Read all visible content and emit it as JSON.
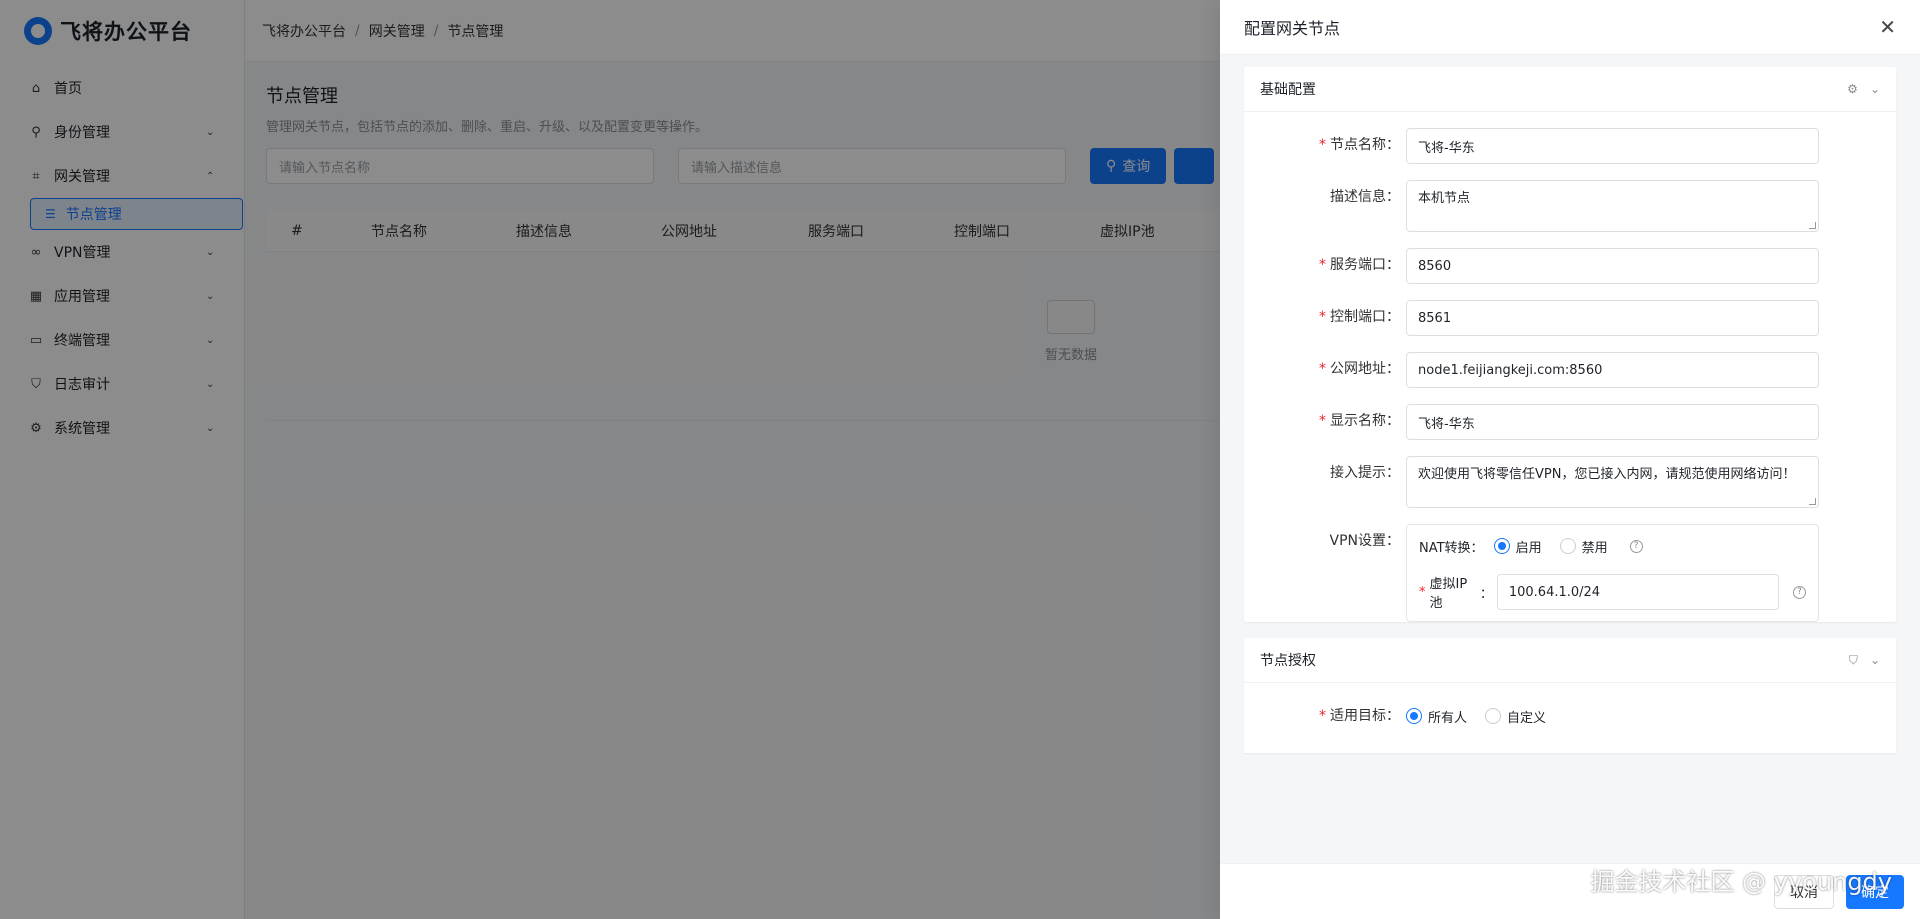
{
  "app": {
    "name": "飞将办公平台"
  },
  "sidebar": {
    "items": [
      {
        "label": "首页",
        "icon": "home-icon",
        "has_arrow": false
      },
      {
        "label": "身份管理",
        "icon": "user-icon",
        "has_arrow": true
      },
      {
        "label": "网关管理",
        "icon": "gateway-icon",
        "has_arrow": true,
        "expanded": true
      },
      {
        "label": "VPN管理",
        "icon": "link-icon",
        "has_arrow": true
      },
      {
        "label": "应用管理",
        "icon": "grid-icon",
        "has_arrow": true
      },
      {
        "label": "终端管理",
        "icon": "laptop-icon",
        "has_arrow": true
      },
      {
        "label": "日志审计",
        "icon": "shield-icon",
        "has_arrow": true
      },
      {
        "label": "系统管理",
        "icon": "gear-icon",
        "has_arrow": true
      }
    ],
    "sub_active": {
      "label": "节点管理",
      "icon": "list-icon"
    }
  },
  "breadcrumb": [
    "飞将办公平台",
    "网关管理",
    "节点管理"
  ],
  "page": {
    "title": "节点管理",
    "description": "管理网关节点，包括节点的添加、删除、重启、升级、以及配置变更等操作。",
    "filters": {
      "name_placeholder": "请输入节点名称",
      "desc_placeholder": "请输入描述信息",
      "query_label": "查询"
    },
    "columns": [
      "#",
      "节点名称",
      "描述信息",
      "公网地址",
      "服务端口",
      "控制端口",
      "虚拟IP池"
    ],
    "empty_text": "暂无数据"
  },
  "drawer": {
    "title": "配置网关节点",
    "close_icon": "close-icon",
    "basic": {
      "title": "基础配置",
      "fields": {
        "node_name": {
          "label": "节点名称",
          "value": "飞将-华东",
          "required": true
        },
        "description": {
          "label": "描述信息",
          "value": "本机节点",
          "required": false
        },
        "service_port": {
          "label": "服务端口",
          "value": "8560",
          "required": true
        },
        "control_port": {
          "label": "控制端口",
          "value": "8561",
          "required": true
        },
        "public_address": {
          "label": "公网地址",
          "value": "node1.feijiangkeji.com:8560",
          "required": true
        },
        "display_name": {
          "label": "显示名称",
          "value": "飞将-华东",
          "required": true
        },
        "access_tip": {
          "label": "接入提示",
          "value": "欢迎使用飞将零信任VPN，您已接入内网，请规范使用网络访问！",
          "required": false
        }
      },
      "vpn": {
        "label": "VPN设置",
        "nat_label": "NAT转换：",
        "nat_options": [
          "启用",
          "禁用"
        ],
        "nat_selected": "启用",
        "pool_label": "虚拟IP池",
        "pool_value": "100.64.1.0/24"
      }
    },
    "auth": {
      "title": "节点授权",
      "target_label": "适用目标",
      "options": [
        "所有人",
        "自定义"
      ],
      "selected": "所有人"
    },
    "footer": {
      "cancel": "取消",
      "ok": "确定"
    }
  },
  "watermark": "掘金技术社区 @ yyoungdy",
  "colors": {
    "primary": "#1677ff",
    "required": "#f5222d"
  }
}
